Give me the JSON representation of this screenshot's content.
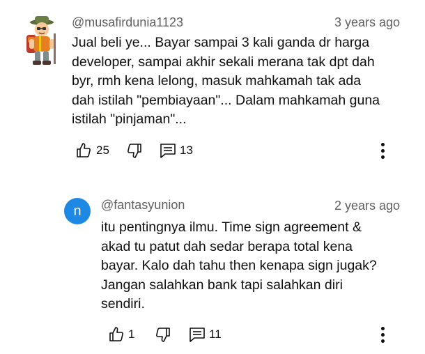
{
  "comments": [
    {
      "author": "@musafirdunia1123",
      "time": "3 years ago",
      "lines": [
        "Jual beli ye... Bayar sampai 3 kali ganda dr harga",
        "developer, sampai akhir sekali merana tak dpt dah",
        "byr, rmh kena lelong, masuk mahkamah tak ada",
        "dah istilah \"pembiayaan\"... Dalam mahkamah guna",
        "istilah \"pinjaman\"..."
      ],
      "likes": "25",
      "replies": "13",
      "avatar_icon": "hiker-avatar"
    },
    {
      "author": "@fantasyunion",
      "time": "2 years ago",
      "avatar_letter": "n",
      "avatar_color": "#1e88e5",
      "lines": [
        "itu pentingnya ilmu. Time sign agreement &",
        "akad tu patut dah sedar berapa total kena",
        "bayar. Kalo dah tahu then kenapa sign jugak?",
        "Jangan salahkan bank tapi salahkan diri",
        "sendiri."
      ],
      "likes": "1",
      "replies": "11"
    }
  ]
}
